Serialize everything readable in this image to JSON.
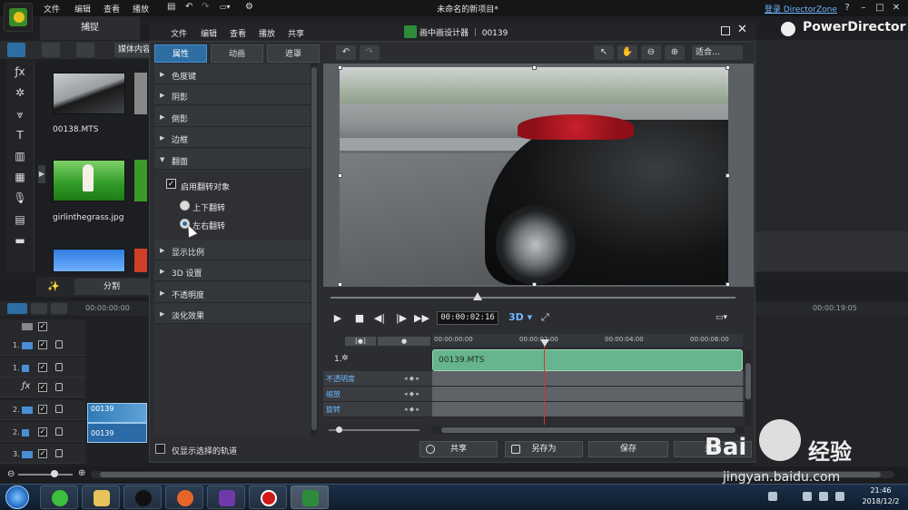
{
  "app": {
    "title": "未命名的新项目*",
    "menu": [
      "文件",
      "编辑",
      "查看",
      "播放"
    ],
    "login_link": "登录 DirectorZone",
    "help": "?",
    "minimize": "–",
    "maximize": "□",
    "close": "✕",
    "brand": "PowerDirector",
    "tab_capture": "捕捉",
    "media_dropdown": "媒体内容"
  },
  "library": {
    "items": [
      {
        "label": "00138.MTS"
      },
      {
        "label": "girlinthegrass.jpg"
      }
    ],
    "split_button": "分割"
  },
  "timeline_main": {
    "ruler_left": "00:00:00:00",
    "ruler_right": "00:00:19:05",
    "track_numbers": [
      "1.",
      "1.",
      "",
      "2.",
      "2.",
      "3."
    ],
    "clip_labels": [
      "00139",
      "00139"
    ]
  },
  "pip_dialog": {
    "title": "画中画设计器 ｜ 00139",
    "menu": [
      "文件",
      "编辑",
      "查看",
      "播放",
      "共享"
    ],
    "tabs": [
      "属性",
      "动画",
      "遮罩"
    ],
    "properties": [
      "色度键",
      "阴影",
      "倒影",
      "边框",
      "翻面",
      "显示比例",
      "3D 设置",
      "不透明度",
      "淡化效果"
    ],
    "flip": {
      "enable_label": "启用翻转对象",
      "option_updown": "上下翻转",
      "option_leftright": "左右翻转",
      "selected": "左右翻转"
    },
    "viewer": {
      "fit_dropdown": "适合..."
    },
    "transport": {
      "timecode": "00:00:02:16",
      "btn_3d": "3D ▾"
    },
    "pip_timeline": {
      "ruler": [
        "00:00:00:00",
        "00:00:02:00",
        "00:00:04:00",
        "00:00:06:00"
      ],
      "track_label": "1.",
      "clip_label": "00139.MTS",
      "keyframe_rows": [
        "不透明度",
        "缩放",
        "旋转"
      ]
    },
    "show_selected_label": "仅显示选择的轨道",
    "buttons": {
      "share": "共享",
      "save_as": "另存为",
      "save": "保存",
      "close": "关闭"
    }
  },
  "taskbar": {
    "time": "21:46",
    "date": "2018/12/2"
  },
  "watermark": {
    "brand": "Bai",
    "brand_suffix": "经验",
    "url": "jingyan.baidu.com"
  },
  "colors": {
    "accent": "#2d6ea3",
    "pip_clip": "#66b58e",
    "playhead": "#e03030"
  }
}
